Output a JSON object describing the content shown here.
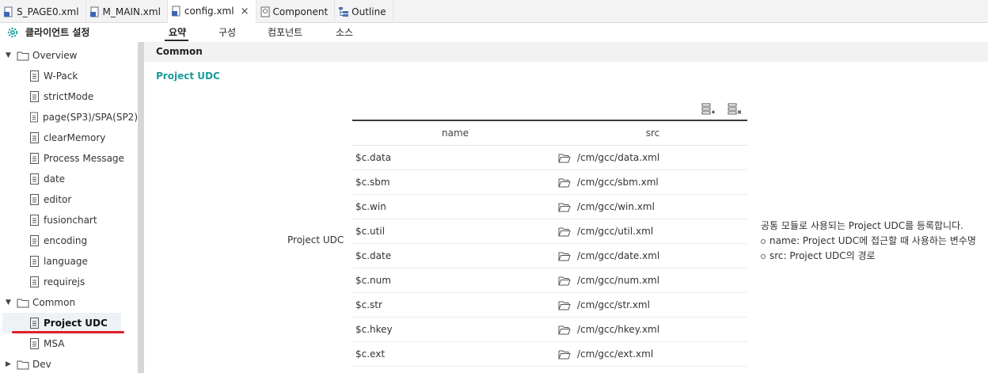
{
  "editor_tabs": [
    {
      "label": "S_PAGE0.xml",
      "icon": "xml-file-icon"
    },
    {
      "label": "M_MAIN.xml",
      "icon": "xml-file-icon"
    },
    {
      "label": "config.xml",
      "icon": "xml-file-icon",
      "close": "×"
    },
    {
      "label": "Component",
      "icon": "component-icon"
    },
    {
      "label": "Outline",
      "icon": "outline-icon"
    }
  ],
  "header": {
    "title": "클라이언트 설정",
    "subtabs": [
      "요약",
      "구성",
      "컴포넌트",
      "소스"
    ]
  },
  "tree": {
    "groups": [
      {
        "label": "Overview",
        "expanded": true,
        "items": [
          "W-Pack",
          "strictMode",
          "page(SP3)/SPA(SP2)",
          "clearMemory",
          "Process Message",
          "date",
          "editor",
          "fusionchart",
          "encoding",
          "language",
          "requirejs"
        ]
      },
      {
        "label": "Common",
        "expanded": true,
        "items": [
          "Project UDC",
          "MSA"
        ]
      },
      {
        "label": "Dev",
        "expanded": false,
        "items": []
      }
    ],
    "selected": "Project UDC"
  },
  "content": {
    "section_title": "Common",
    "sub_heading": "Project UDC",
    "row_label": "Project UDC",
    "table": {
      "columns": [
        "name",
        "src"
      ],
      "rows": [
        [
          "$c.data",
          "/cm/gcc/data.xml"
        ],
        [
          "$c.sbm",
          "/cm/gcc/sbm.xml"
        ],
        [
          "$c.win",
          "/cm/gcc/win.xml"
        ],
        [
          "$c.util",
          "/cm/gcc/util.xml"
        ],
        [
          "$c.date",
          "/cm/gcc/date.xml"
        ],
        [
          "$c.num",
          "/cm/gcc/num.xml"
        ],
        [
          "$c.str",
          "/cm/gcc/str.xml"
        ],
        [
          "$c.hkey",
          "/cm/gcc/hkey.xml"
        ],
        [
          "$c.ext",
          "/cm/gcc/ext.xml"
        ]
      ]
    },
    "help": {
      "line1": "공통 모듈로 사용되는 Project UDC를 등록합니다.",
      "line2": "name: Project UDC에 접근할 때 사용하는 변수명",
      "line3": "src: Project UDC의 경로"
    }
  },
  "colors": {
    "accent_teal": "#1a9c9c",
    "highlight_red": "#e0202a"
  }
}
